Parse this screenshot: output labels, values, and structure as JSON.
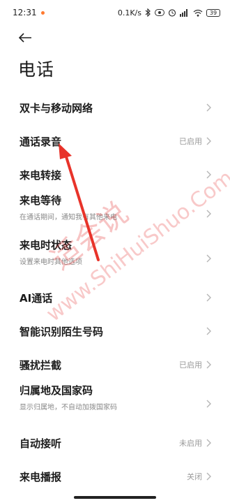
{
  "status_bar": {
    "time": "12:31",
    "net_speed": "0.1K/s",
    "battery": "39",
    "icons": [
      "bluetooth-icon",
      "hd-icon",
      "alarm-icon",
      "signal-icon",
      "wifi-icon",
      "battery-icon"
    ]
  },
  "header": {
    "back_icon": "arrow-left-icon",
    "title": "电话"
  },
  "settings": [
    {
      "title": "双卡与移动网络",
      "subtitle": "",
      "status": ""
    },
    {
      "title": "通话录音",
      "subtitle": "",
      "status": "已启用"
    },
    {
      "title": "来电转接",
      "subtitle": "",
      "status": ""
    },
    {
      "title": "来电等待",
      "subtitle": "在通话期间，通知我有其他来电",
      "status": ""
    },
    {
      "title": "来电时状态",
      "subtitle": "设置来电时其他选项",
      "status": ""
    },
    {
      "title": "AI通话",
      "subtitle": "",
      "status": ""
    },
    {
      "title": "智能识别陌生号码",
      "subtitle": "",
      "status": ""
    },
    {
      "title": "骚扰拦截",
      "subtitle": "",
      "status": "已启用"
    },
    {
      "title": "归属地及国家码",
      "subtitle": "显示归属地，不自动加拨国家码",
      "status": ""
    },
    {
      "title": "自动接听",
      "subtitle": "",
      "status": "未启用"
    },
    {
      "title": "来电播报",
      "subtitle": "",
      "status": "关闭"
    }
  ],
  "watermark": {
    "cn": "适会说",
    "en": "www.ShiHuiShuo.Com"
  },
  "colors": {
    "annotation_arrow": "#e8332a",
    "chevron": "#b5b5b5"
  }
}
